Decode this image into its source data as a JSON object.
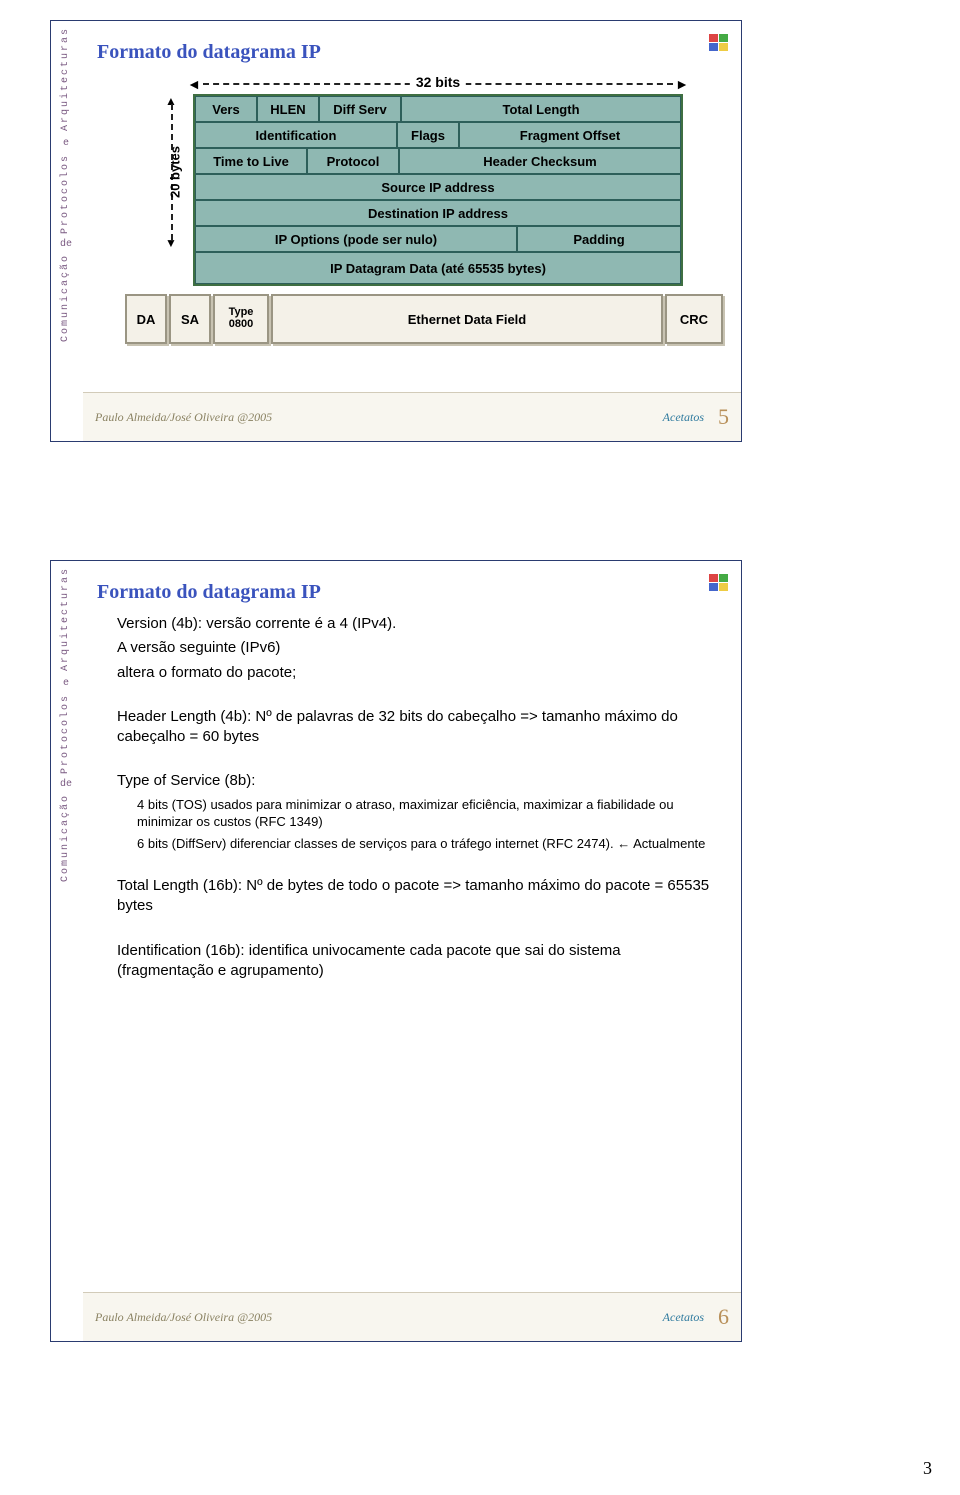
{
  "titles": {
    "slideA": "Formato do datagrama IP",
    "slideB": "Formato do datagrama IP"
  },
  "sidebar": {
    "line1": "Arquitecturas",
    "sep": "e",
    "line2": "Protocolos",
    "line3": "de",
    "line4": "Comunicação"
  },
  "ip": {
    "bitsLabel": "32 bits",
    "bytesLabel": "20 bytes",
    "rows": {
      "r1": {
        "vers": "Vers",
        "hlen": "HLEN",
        "diff": "Diff Serv",
        "tlen": "Total Length"
      },
      "r2": {
        "id": "Identification",
        "flags": "Flags",
        "frag": "Fragment Offset"
      },
      "r3": {
        "ttl": "Time to Live",
        "proto": "Protocol",
        "chk": "Header Checksum"
      },
      "r4": {
        "src": "Source IP address"
      },
      "r5": {
        "dst": "Destination IP address"
      },
      "r6": {
        "opt": "IP Options (pode ser nulo)",
        "pad": "Padding"
      },
      "r7": {
        "data": "IP Datagram Data  (até 65535 bytes)"
      }
    }
  },
  "eth": {
    "da": "DA",
    "sa": "SA",
    "type1": "Type",
    "type2": "0800",
    "data": "Ethernet Data Field",
    "crc": "CRC"
  },
  "body": {
    "version": "Version (4b): versão corrente é a 4 (IPv4).",
    "version2": "A versão seguinte (IPv6)",
    "version3": "altera o formato do pacote;",
    "hlen": "Header Length (4b): Nº de palavras de 32 bits do cabeçalho => tamanho máximo do cabeçalho = 60 bytes",
    "tos": "Type of Service (8b):",
    "tos_a": "4 bits (TOS) usados para minimizar o atraso, maximizar eficiência, maximizar a fiabilidade ou minimizar os custos (RFC 1349)",
    "tos_b": "6 bits (DiffServ)  diferenciar classes de serviços para o tráfego internet (RFC 2474). ← Actualmente",
    "tlen": "Total Length (16b): Nº de bytes de todo o pacote => tamanho máximo do pacote = 65535 bytes",
    "ident": "Identification (16b): identifica univocamente cada pacote que sai do sistema (fragmentação e agrupamento)"
  },
  "footer": {
    "author": "Paulo Almeida/José Oliveira  @2005",
    "acetatos": "Acetatos",
    "pageA": "5",
    "pageB": "6"
  },
  "pageNumber": "3"
}
